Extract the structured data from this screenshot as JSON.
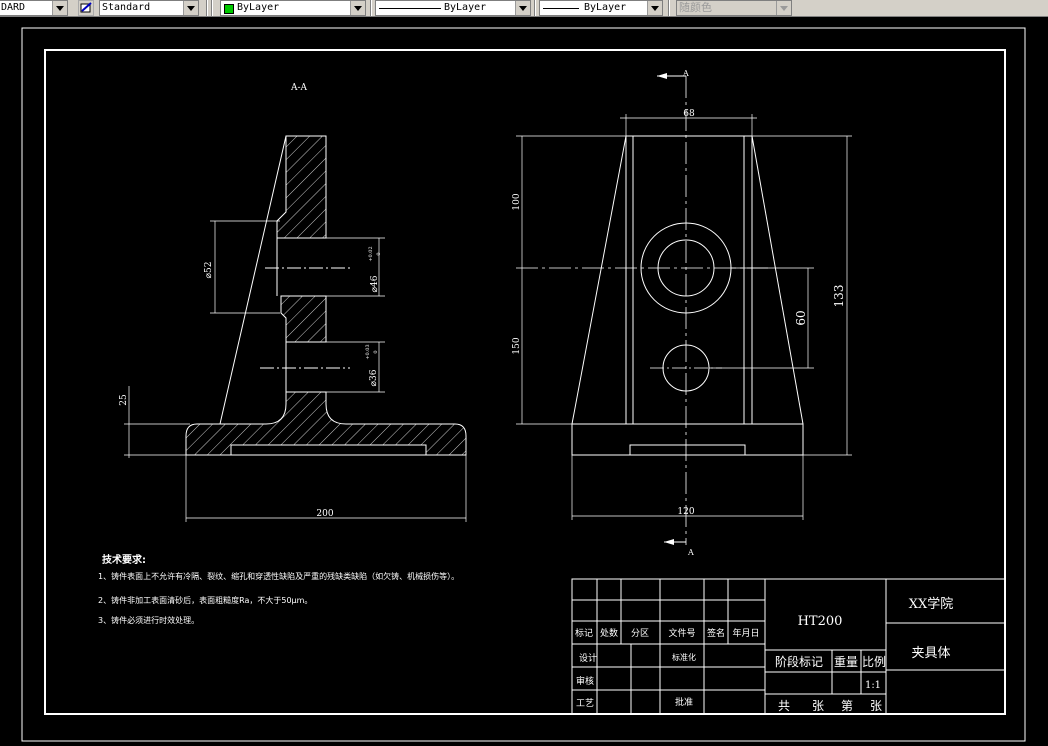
{
  "toolbar": {
    "textstyle_value": "DARD",
    "dimstyle_value": "Standard",
    "layer_value": "ByLayer",
    "linetype_value": "ByLayer",
    "lineweight_value": "ByLayer",
    "plotstyle_value": "随颜色",
    "layer_color": "#00c800"
  },
  "drawing": {
    "section_label": "A-A",
    "section_mark_top": "A",
    "section_mark_bottom": "A",
    "dims": {
      "width_200": "200",
      "height_25": "25",
      "dia_52": "⌀52",
      "dia_46": "⌀46",
      "tol_46_upper": "+0.02",
      "tol_46_lower": "0",
      "dia_36": "⌀36",
      "tol_36_upper": "+0.03",
      "tol_36_lower": "0",
      "top_width": "68",
      "height_100": "100",
      "height_150": "150",
      "height_133": "133",
      "height_60": "60",
      "bottom_width": "120"
    }
  },
  "notes": {
    "title": "技术要求:",
    "items": [
      "1、铸件表面上不允许有冷隔、裂纹、缩孔和穿透性缺陷及严重的残缺类缺陷（如欠铸、机械损伤等）。",
      "2、铸件非加工表面清砂后，表面粗糙度Ra，不大于50μm。",
      "3、铸件必须进行时效处理。"
    ]
  },
  "title_block": {
    "material": "HT200",
    "school": "XX学院",
    "part_name": "夹具体",
    "labels": {
      "mark": "标记",
      "count": "处数",
      "zone": "分区",
      "doc_no": "文件号",
      "sign": "签名",
      "date": "年月日",
      "design": "设计",
      "standardize": "标准化",
      "review": "审核",
      "process": "工艺",
      "approve": "批准",
      "stage_mark": "阶段标记",
      "weight": "重量",
      "scale": "比例",
      "scale_value": "1:1",
      "total": "共",
      "sheet": "张",
      "page": "第",
      "sheet2": "张"
    }
  }
}
